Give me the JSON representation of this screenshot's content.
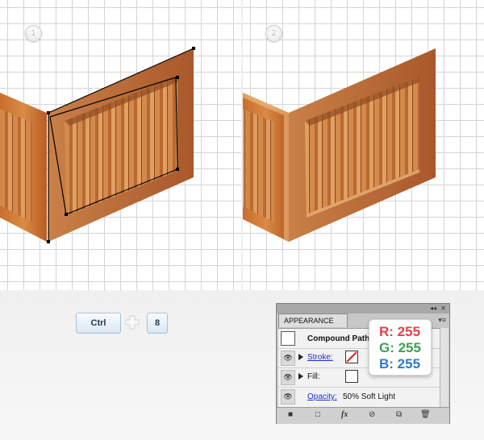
{
  "steps": [
    "1",
    "2"
  ],
  "shortcut": {
    "key1": "Ctrl",
    "key2": "8"
  },
  "appearance_panel": {
    "tab_title": "APPEARANCE",
    "collapse_glyph": "◂◂",
    "close_glyph": "✕",
    "menu_glyph": "▾≡",
    "object_name": "Compound Path",
    "stroke_label": "Stroke:",
    "fill_label": "Fill:",
    "opacity_label": "Opacity:",
    "opacity_value": "50% Soft Light",
    "footer_icons": [
      "square-icon",
      "new-layer-icon",
      "fx-icon",
      "clear-icon",
      "duplicate-icon",
      "trash-icon"
    ],
    "fx_text": "fx"
  },
  "color_tooltip": {
    "r": "R: 255",
    "g": "G: 255",
    "b": "B: 255"
  },
  "colors": {
    "wood_light": "#e3a469",
    "wood_mid": "#c8773b",
    "wood_dark": "#9a4d1e",
    "r": "#e6404b",
    "g": "#3aa253",
    "b": "#2f7cc4"
  }
}
